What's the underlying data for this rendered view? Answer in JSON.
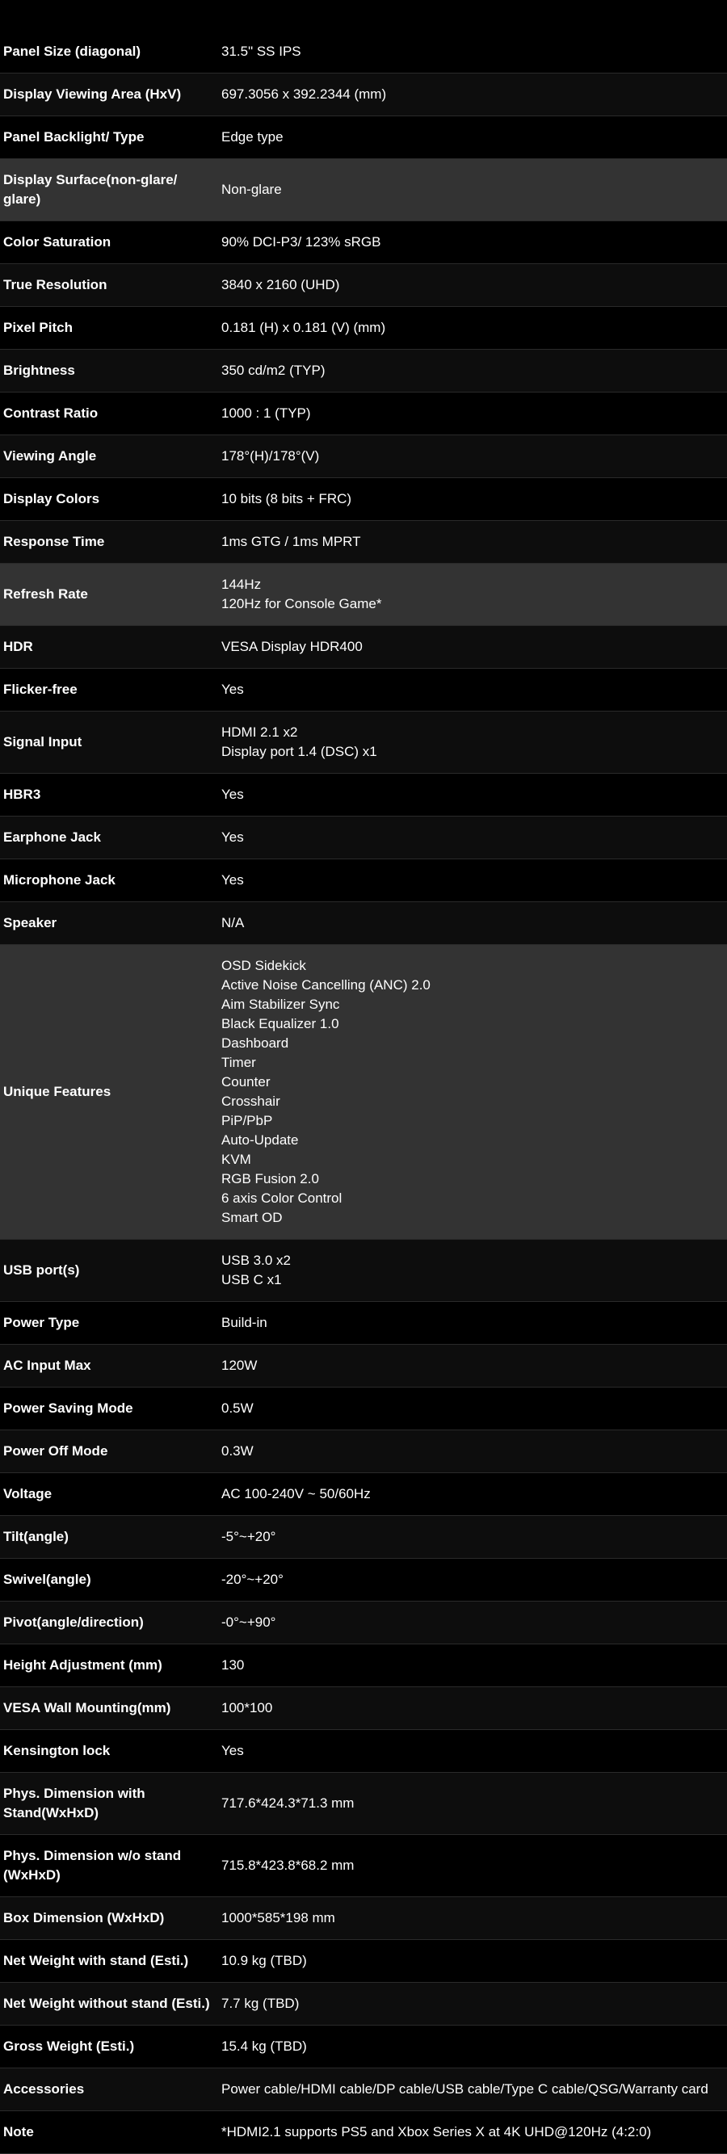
{
  "specs": [
    {
      "label": "Panel Size (diagonal)",
      "value": [
        "31.5\" SS IPS"
      ]
    },
    {
      "label": "Display Viewing Area (HxV)",
      "value": [
        "697.3056 x 392.2344 (mm)"
      ]
    },
    {
      "label": "Panel Backlight/ Type",
      "value": [
        "Edge type"
      ]
    },
    {
      "label": "Display Surface(non-glare/ glare)",
      "value": [
        "Non-glare"
      ]
    },
    {
      "label": "Color Saturation",
      "value": [
        "90% DCI-P3/ 123% sRGB"
      ]
    },
    {
      "label": "True Resolution",
      "value": [
        "3840 x 2160 (UHD)"
      ]
    },
    {
      "label": "Pixel Pitch",
      "value": [
        "0.181 (H) x 0.181 (V) (mm)"
      ]
    },
    {
      "label": "Brightness",
      "value": [
        "350 cd/m2 (TYP)"
      ]
    },
    {
      "label": "Contrast Ratio",
      "value": [
        "1000 : 1 (TYP)"
      ]
    },
    {
      "label": "Viewing Angle",
      "value": [
        "178°(H)/178°(V)"
      ]
    },
    {
      "label": "Display Colors",
      "value": [
        "10 bits (8 bits + FRC)"
      ]
    },
    {
      "label": "Response Time",
      "value": [
        "1ms GTG / 1ms MPRT"
      ]
    },
    {
      "label": "Refresh Rate",
      "value": [
        "144Hz",
        "120Hz for Console Game*"
      ]
    },
    {
      "label": "HDR",
      "value": [
        "VESA Display HDR400"
      ]
    },
    {
      "label": "Flicker-free",
      "value": [
        "Yes"
      ]
    },
    {
      "label": "Signal Input",
      "value": [
        "HDMI 2.1 x2",
        "Display port 1.4 (DSC) x1"
      ]
    },
    {
      "label": "HBR3",
      "value": [
        "Yes"
      ]
    },
    {
      "label": "Earphone Jack",
      "value": [
        "Yes"
      ]
    },
    {
      "label": "Microphone Jack",
      "value": [
        "Yes"
      ]
    },
    {
      "label": "Speaker",
      "value": [
        "N/A"
      ]
    },
    {
      "label": "Unique Features",
      "value": [
        "OSD Sidekick",
        "Active Noise Cancelling (ANC) 2.0",
        "Aim Stabilizer Sync",
        "Black Equalizer 1.0",
        "Dashboard",
        "Timer",
        "Counter",
        "Crosshair",
        "PiP/PbP",
        "Auto-Update",
        "KVM",
        "RGB Fusion 2.0",
        "6 axis Color Control",
        "Smart OD"
      ]
    },
    {
      "label": "USB port(s)",
      "value": [
        "USB 3.0 x2",
        "USB C x1"
      ]
    },
    {
      "label": "Power Type",
      "value": [
        "Build-in"
      ]
    },
    {
      "label": "AC Input Max",
      "value": [
        "120W"
      ]
    },
    {
      "label": "Power Saving Mode",
      "value": [
        "0.5W"
      ]
    },
    {
      "label": "Power Off Mode",
      "value": [
        "0.3W"
      ]
    },
    {
      "label": "Voltage",
      "value": [
        "AC 100-240V ~ 50/60Hz"
      ]
    },
    {
      "label": "Tilt(angle)",
      "value": [
        "-5°~+20°"
      ]
    },
    {
      "label": "Swivel(angle)",
      "value": [
        "-20°~+20°"
      ]
    },
    {
      "label": "Pivot(angle/direction)",
      "value": [
        "-0°~+90°"
      ]
    },
    {
      "label": "Height Adjustment (mm)",
      "value": [
        "130"
      ]
    },
    {
      "label": "VESA Wall Mounting(mm)",
      "value": [
        "100*100"
      ]
    },
    {
      "label": "Kensington lock",
      "value": [
        "Yes"
      ]
    },
    {
      "label": "Phys. Dimension with Stand(WxHxD)",
      "value": [
        "717.6*424.3*71.3 mm"
      ]
    },
    {
      "label": "Phys. Dimension w/o stand (WxHxD)",
      "value": [
        "715.8*423.8*68.2 mm"
      ]
    },
    {
      "label": "Box Dimension (WxHxD)",
      "value": [
        "1000*585*198 mm"
      ]
    },
    {
      "label": "Net Weight with stand (Esti.)",
      "value": [
        "10.9 kg (TBD)"
      ]
    },
    {
      "label": "Net Weight without stand (Esti.)",
      "value": [
        "7.7 kg (TBD)"
      ]
    },
    {
      "label": "Gross Weight (Esti.)",
      "value": [
        "15.4 kg (TBD)"
      ]
    },
    {
      "label": "Accessories",
      "value": [
        "Power cable/HDMI cable/DP cable/USB cable/Type C cable/QSG/Warranty card"
      ]
    },
    {
      "label": "Note",
      "value": [
        "*HDMI2.1 supports PS5 and Xbox Series X at 4K UHD@120Hz (4:2:0)"
      ]
    }
  ],
  "highlighted_rows": [
    "Display Surface(non-glare/ glare)",
    "Refresh Rate",
    "Unique Features"
  ],
  "colors": {
    "background": "#000000",
    "row_alt": "#0d0d0d",
    "row_highlight": "#333333",
    "divider": "#2a2a2a",
    "text": "#ffffff"
  }
}
